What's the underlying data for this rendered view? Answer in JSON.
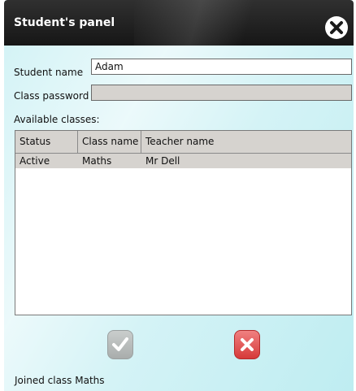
{
  "window": {
    "title": "Student's panel"
  },
  "form": {
    "student_name_label": "Student name",
    "student_name_value": "Adam",
    "class_password_label": "Class password",
    "class_password_value": "",
    "available_classes_label": "Available classes:"
  },
  "table": {
    "columns": [
      "Status",
      "Class name",
      "Teacher name"
    ],
    "rows": [
      {
        "status": "Active",
        "class_name": "Maths",
        "teacher_name": "Mr Dell"
      }
    ]
  },
  "buttons": {
    "ok": "checkmark-icon",
    "cancel": "x-icon"
  },
  "status_bar": {
    "message": "Joined class Maths"
  },
  "colors": {
    "titlebar": "#1e1e1e",
    "panel_bg": "#d4f3f6",
    "header_bg": "#d6d3cf",
    "cancel_red": "#d63a3a",
    "ok_gray": "#b5b9b8"
  }
}
